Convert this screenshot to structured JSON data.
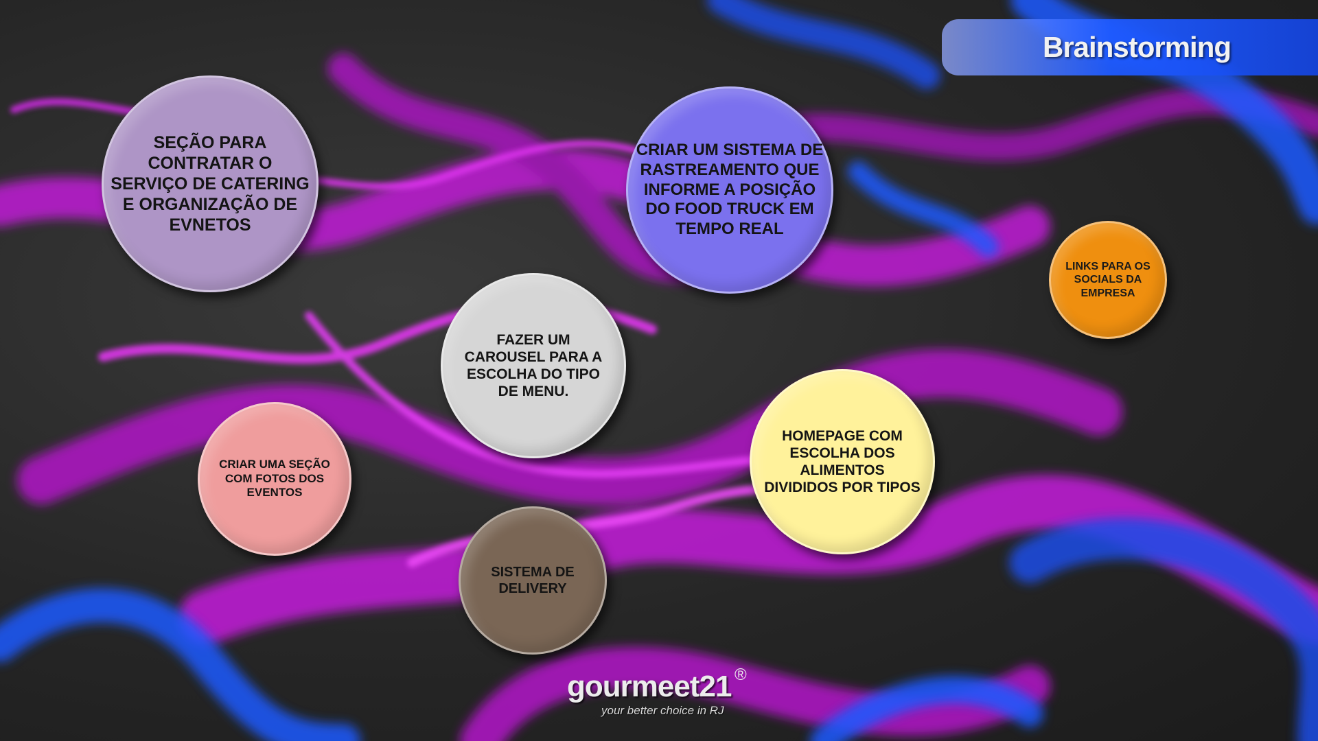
{
  "slide": {
    "title": "Brainstorming"
  },
  "bubbles": [
    {
      "text": "SEÇÃO PARA CONTRATAR O SERVIÇO DE CATERING E ORGANIZAÇÃO DE EVNETOS",
      "color": "#ae95c6"
    },
    {
      "text": "CRIAR UM SISTEMA DE RASTREAMENTO QUE INFORME A POSIÇÃO DO FOOD TRUCK EM TEMPO REAL",
      "color": "#7b71ee"
    },
    {
      "text": "FAZER UM CAROUSEL PARA A ESCOLHA DO TIPO DE MENU.",
      "color": "#d6d6d6"
    },
    {
      "text": "LINKS PARA OS SOCIALS DA EMPRESA",
      "color": "#ef8f0f"
    },
    {
      "text": "CRIAR UMA SEÇÃO COM FOTOS DOS EVENTOS",
      "color": "#ef9d9d"
    },
    {
      "text": "HOMEPAGE COM ESCOLHA DOS ALIMENTOS DIVIDIDOS POR TIPOS",
      "color": "#fff29b"
    },
    {
      "text": "SISTEMA DE DELIVERY",
      "color": "#7a6655"
    }
  ],
  "logo": {
    "name": "gourmeet21",
    "registered": "®",
    "tagline": "your better choice in RJ"
  },
  "colors": {
    "smoke_magenta": "#d21ee6",
    "smoke_blue": "#1e5aff",
    "background": "#262626"
  }
}
